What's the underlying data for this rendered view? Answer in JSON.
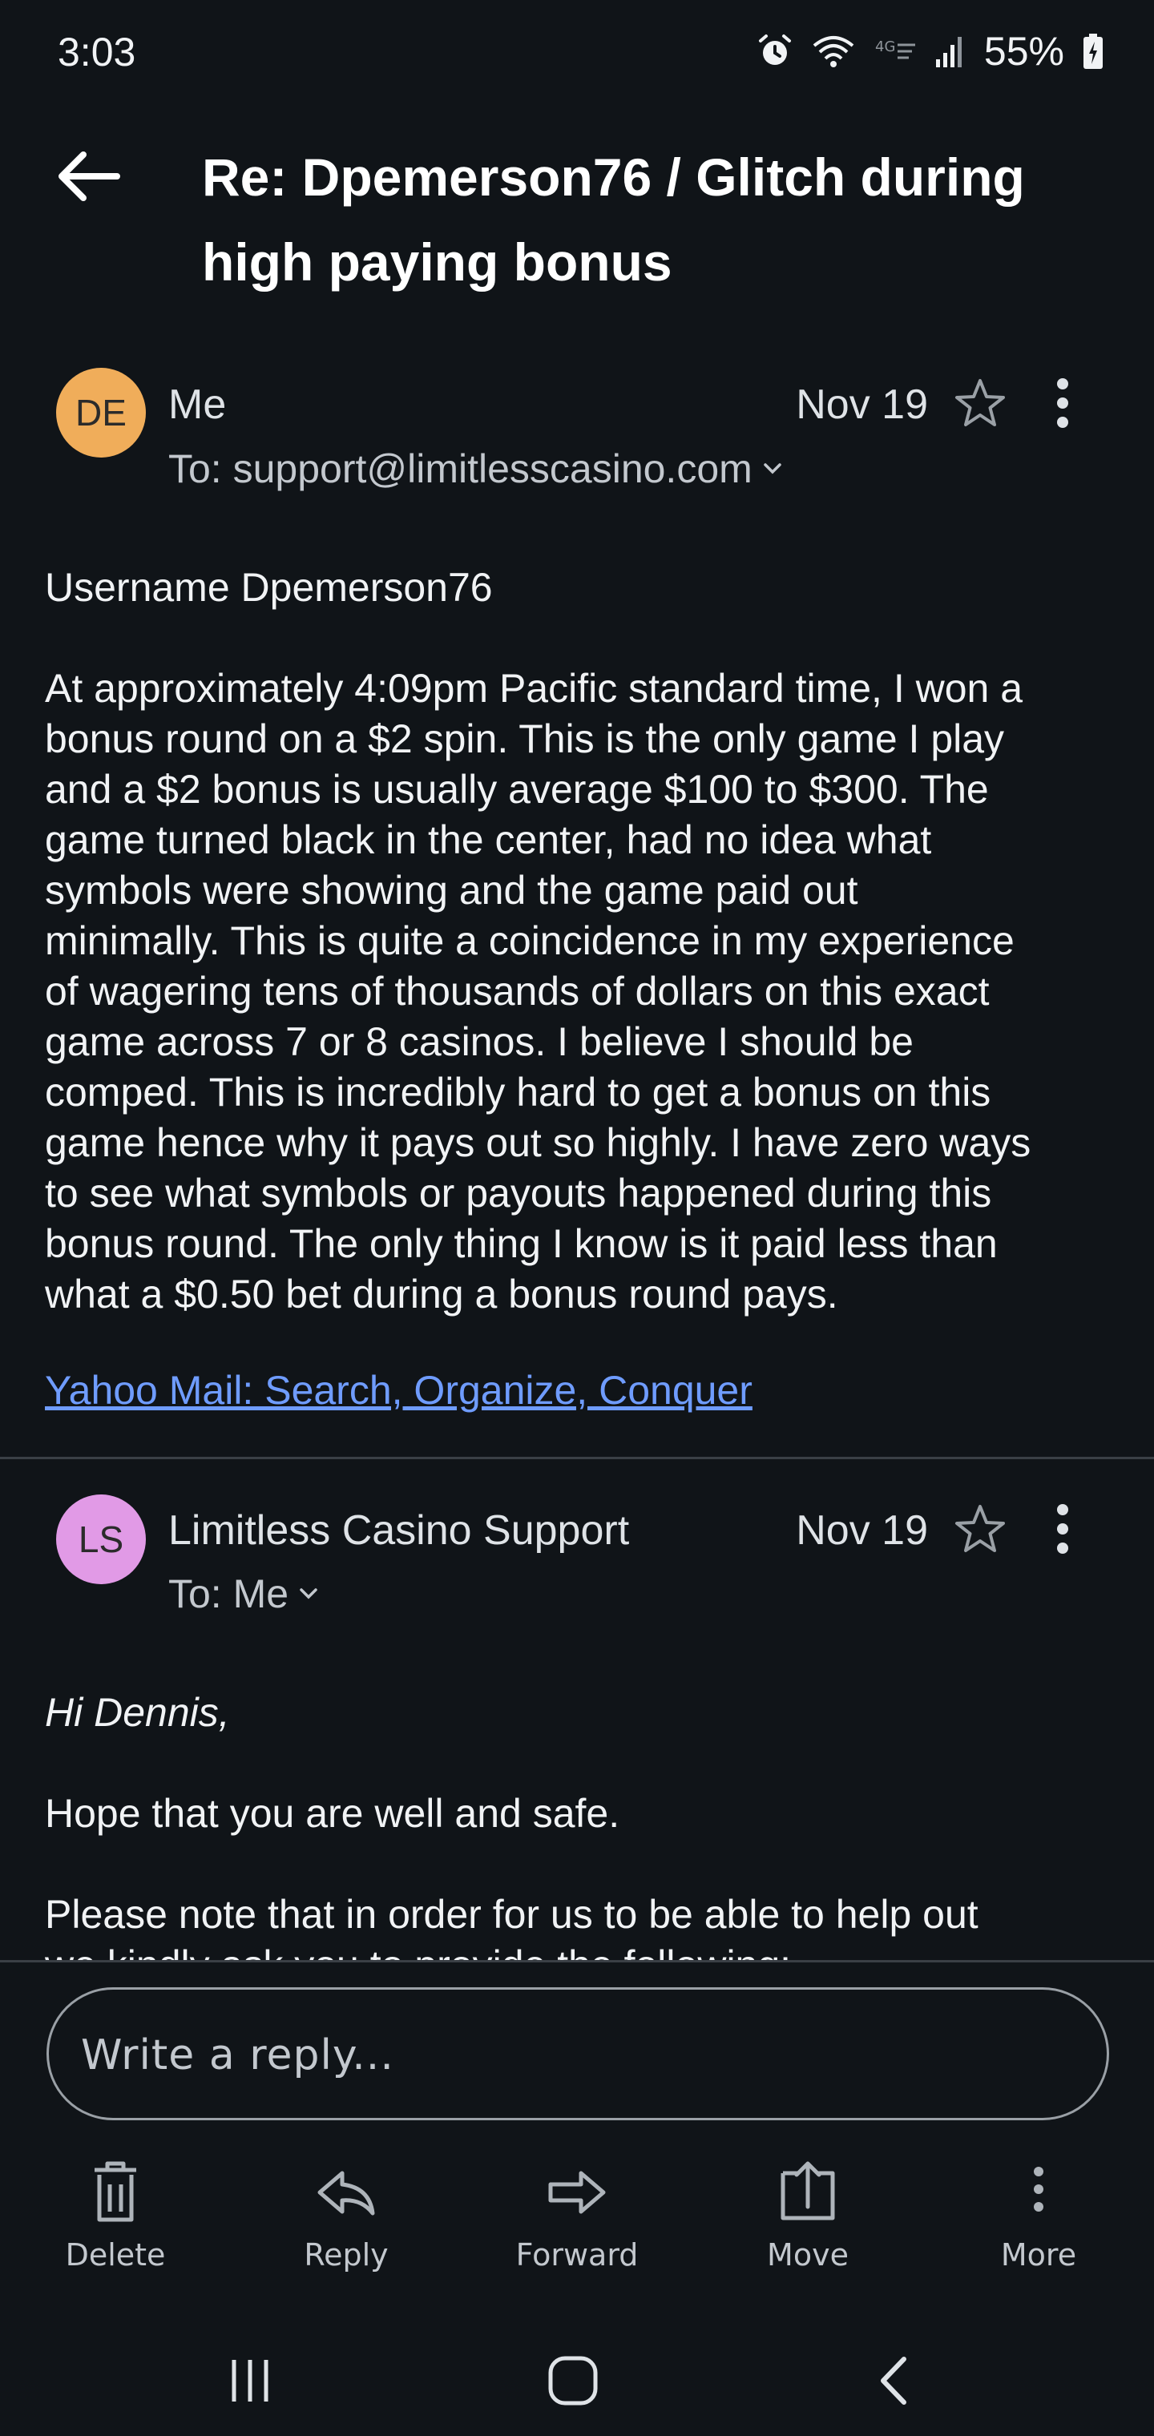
{
  "status_bar": {
    "time": "3:03",
    "battery": "55%",
    "icons": [
      "alarm-icon",
      "wifi-icon",
      "lte-icon",
      "signal-icon",
      "battery-icon"
    ]
  },
  "header": {
    "back_icon": "arrow-left-icon",
    "subject_line1": "Re: Dpemerson76 / Glitch during",
    "subject_line2": "high paying bonus"
  },
  "messages": [
    {
      "avatar_initials": "DE",
      "avatar_color": "#f0ad5a",
      "sender": "Me",
      "to": "To: support@limitlesscasino.com",
      "date": "Nov 19",
      "body_line1": "Username Dpemerson76",
      "body_lines": [
        "At approximately 4:09pm Pacific standard time, I won a",
        "bonus round on a $2 spin. This is the only game I play",
        "and a $2 bonus is usually average $100 to $300. The",
        "game turned black in the center, had no idea what",
        "symbols were showing and the game paid out",
        "minimally. This is quite a coincidence in my experience",
        "of wagering tens of thousands of dollars on this exact",
        "game across 7 or 8 casinos. I believe I should be",
        "comped. This is incredibly hard to get a bonus on this",
        "game hence why it pays out so highly. I have zero ways",
        "to see what symbols or payouts happened during this",
        "bonus round. The only thing I know is it paid less than",
        "what a $0.50 bet during a bonus round pays."
      ],
      "signature": "Yahoo Mail: Search, Organize, Conquer"
    },
    {
      "avatar_initials": "LS",
      "avatar_color": "#e19ae6",
      "sender": "Limitless Casino Support",
      "to": "To: Me",
      "date": "Nov 19",
      "greeting": "Hi Dennis,",
      "line1": "Hope that you are well and safe.",
      "line2": "Please note that in order for us to be able to help out",
      "line3": "we kindly ask you to provide the following:"
    }
  ],
  "reply": {
    "placeholder": "Write a reply..."
  },
  "actions": {
    "delete": "Delete",
    "reply": "Reply",
    "forward": "Forward",
    "move": "Move",
    "more": "More"
  },
  "colors": {
    "background": "#101418",
    "link": "#6f9cff",
    "divider": "#3a3f45"
  }
}
